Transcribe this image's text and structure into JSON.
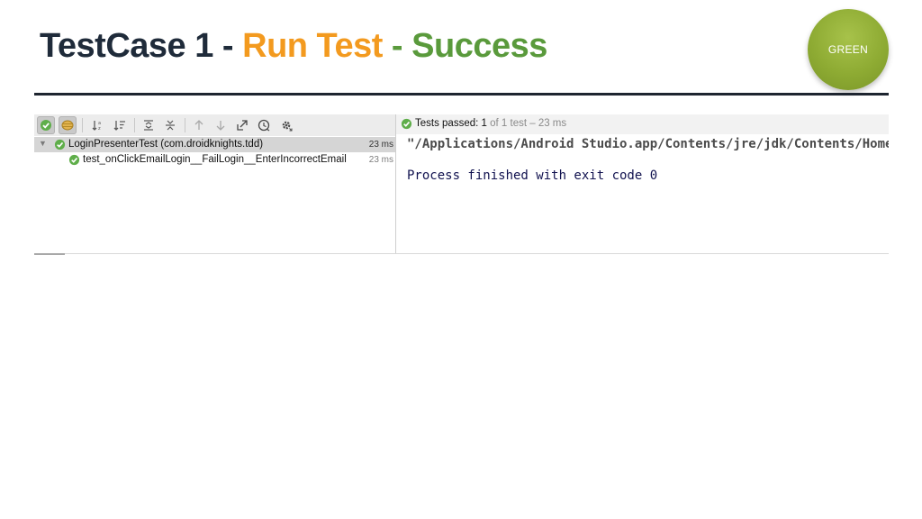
{
  "slide": {
    "title_part1": "TestCase 1 - ",
    "title_part2": "Run Test",
    "title_part3": " - ",
    "title_part4": "Success",
    "badge_label": "GREEN",
    "colors": {
      "title_dark": "#1f2b3a",
      "accent_orange": "#f39a1f",
      "accent_green": "#5a9a3c",
      "badge": "#8eab33"
    }
  },
  "toolbar": {
    "buttons": [
      {
        "name": "show-passed-icon",
        "pressed": true
      },
      {
        "name": "show-ignored-icon",
        "pressed": true
      },
      {
        "name": "sort-alphabetically-icon",
        "pressed": false
      },
      {
        "name": "sort-by-duration-icon",
        "pressed": false
      },
      {
        "name": "expand-all-icon",
        "pressed": false
      },
      {
        "name": "collapse-all-icon",
        "pressed": false
      },
      {
        "name": "previous-failed-icon",
        "pressed": false
      },
      {
        "name": "next-failed-icon",
        "pressed": false
      },
      {
        "name": "export-results-icon",
        "pressed": false
      },
      {
        "name": "test-history-icon",
        "pressed": false
      },
      {
        "name": "settings-gear-icon",
        "pressed": false
      }
    ]
  },
  "tree": {
    "suite": {
      "label": "LoginPresenterTest (com.droidknights.tdd)",
      "time": "23 ms",
      "status": "passed"
    },
    "tests": [
      {
        "label": "test_onClickEmailLogin__FailLogin__EnterIncorrectEmail",
        "time": "23 ms",
        "status": "passed"
      }
    ]
  },
  "status": {
    "prefix": "Tests passed: ",
    "passed_count": "1",
    "suffix": " of 1 test – 23 ms"
  },
  "console": {
    "command_line": "\"/Applications/Android Studio.app/Contents/jre/jdk/Contents/Home/bin/java\"",
    "blank": "",
    "exit_line": "Process finished with exit code 0"
  }
}
